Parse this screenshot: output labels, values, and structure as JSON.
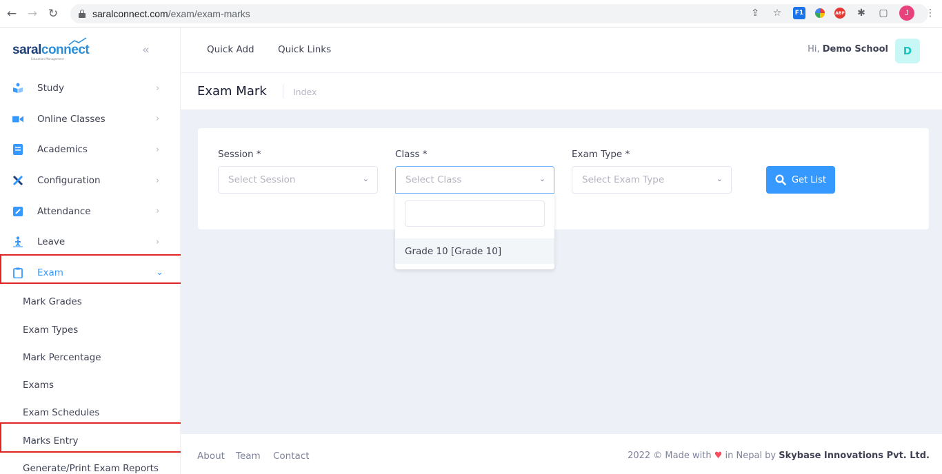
{
  "browser": {
    "url_domain": "saralconnect.com",
    "url_path": "/exam/exam-marks",
    "profile_initial": "J",
    "ext_f1": "F1",
    "ext_abp": "ABP"
  },
  "sidebar": {
    "logo_part1": "saral",
    "logo_part2": "connect",
    "logo_sub": "Education Management",
    "menu": [
      {
        "label": "Study",
        "icon": "book-reader-icon"
      },
      {
        "label": "Online Classes",
        "icon": "video-camera-icon"
      },
      {
        "label": "Academics",
        "icon": "notebook-icon"
      },
      {
        "label": "Configuration",
        "icon": "tools-icon"
      },
      {
        "label": "Attendance",
        "icon": "edit-square-icon"
      },
      {
        "label": "Leave",
        "icon": "person-walking-icon"
      },
      {
        "label": "Exam",
        "icon": "clipboard-icon"
      }
    ],
    "exam_submenu": [
      "Mark Grades",
      "Exam Types",
      "Mark Percentage",
      "Exams",
      "Exam Schedules",
      "Marks Entry",
      "Generate/Print Exam Reports"
    ]
  },
  "header": {
    "quick_add": "Quick Add",
    "quick_links": "Quick Links",
    "greeting_prefix": "Hi,",
    "user_name": "Demo School",
    "user_initial": "D"
  },
  "subheader": {
    "title": "Exam Mark",
    "breadcrumb": "Index"
  },
  "form": {
    "session_label": "Session *",
    "session_placeholder": "Select Session",
    "class_label": "Class *",
    "class_placeholder": "Select Class",
    "exam_type_label": "Exam Type *",
    "exam_type_placeholder": "Select Exam Type",
    "get_list_label": "Get List",
    "class_options": [
      "Grade 10 [Grade 10]"
    ]
  },
  "footer": {
    "links": [
      "About",
      "Team",
      "Contact"
    ],
    "copyright_prefix": "2022 ©  Made with",
    "copyright_mid": "in Nepal by",
    "company": "Skybase Innovations Pvt. Ltd."
  },
  "colors": {
    "accent": "#3699ff",
    "highlight": "#e02424",
    "content_bg": "#eef0f8"
  }
}
